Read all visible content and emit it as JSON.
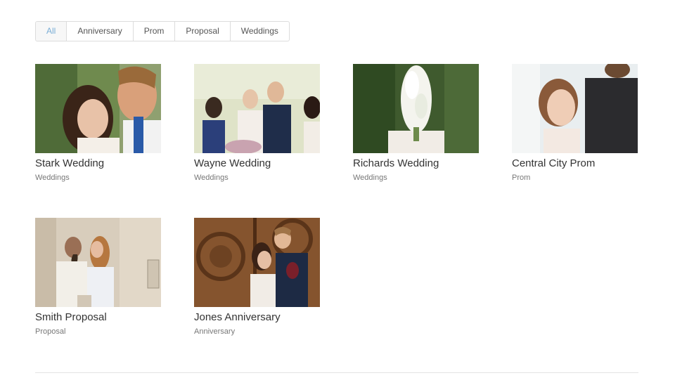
{
  "filters": {
    "items": [
      {
        "label": "All",
        "active": true
      },
      {
        "label": "Anniversary",
        "active": false
      },
      {
        "label": "Prom",
        "active": false
      },
      {
        "label": "Proposal",
        "active": false
      },
      {
        "label": "Weddings",
        "active": false
      }
    ]
  },
  "gallery": {
    "items": [
      {
        "title": "Stark Wedding",
        "category": "Weddings",
        "photo": "couple-closeup-photo"
      },
      {
        "title": "Wayne Wedding",
        "category": "Weddings",
        "photo": "wedding-party-photo"
      },
      {
        "title": "Richards Wedding",
        "category": "Weddings",
        "photo": "bridal-bouquet-photo"
      },
      {
        "title": "Central City Prom",
        "category": "Prom",
        "photo": "prom-portrait-photo"
      },
      {
        "title": "Smith Proposal",
        "category": "Proposal",
        "photo": "proposal-kiss-photo"
      },
      {
        "title": "Jones Anniversary",
        "category": "Anniversary",
        "photo": "anniversary-door-photo"
      }
    ]
  }
}
